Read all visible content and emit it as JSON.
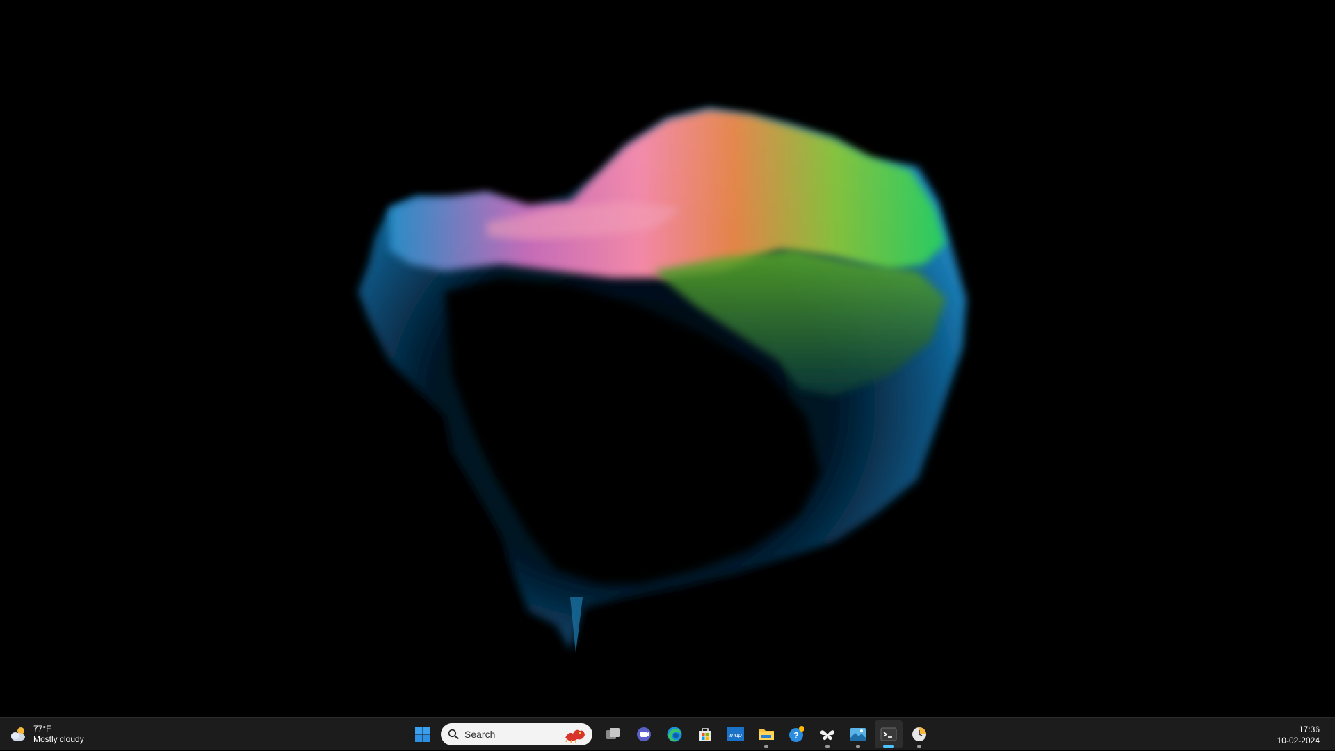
{
  "taskbar": {
    "weather": {
      "temperature": "77°F",
      "condition": "Mostly cloudy",
      "icon": "cloud-sun-icon"
    },
    "search": {
      "placeholder": "Search",
      "highlight_icon": "dragon-icon"
    },
    "apps": [
      {
        "name": "task-view",
        "icon": "task-view-icon"
      },
      {
        "name": "teams",
        "icon": "teams-chat-icon"
      },
      {
        "name": "edge",
        "icon": "edge-icon"
      },
      {
        "name": "store",
        "icon": "microsoft-store-icon"
      },
      {
        "name": "mdp",
        "icon": "mdp-icon",
        "label": "mdp"
      },
      {
        "name": "file-explorer",
        "icon": "folder-icon",
        "running": true
      },
      {
        "name": "get-help",
        "icon": "help-icon"
      },
      {
        "name": "app-butterfly",
        "icon": "butterfly-icon",
        "running": true
      },
      {
        "name": "photo-viewer",
        "icon": "image-viewer-icon",
        "running": true
      },
      {
        "name": "terminal",
        "icon": "terminal-icon",
        "running": true,
        "focused": true
      },
      {
        "name": "clock-app",
        "icon": "clock-icon",
        "running": true
      }
    ],
    "clock": {
      "time": "17:36",
      "date": "10-02-2024"
    }
  },
  "colors": {
    "taskbar_bg": "#1c1c1c",
    "accent": "#4cc2ff",
    "wallpaper_bg": "#000000"
  }
}
